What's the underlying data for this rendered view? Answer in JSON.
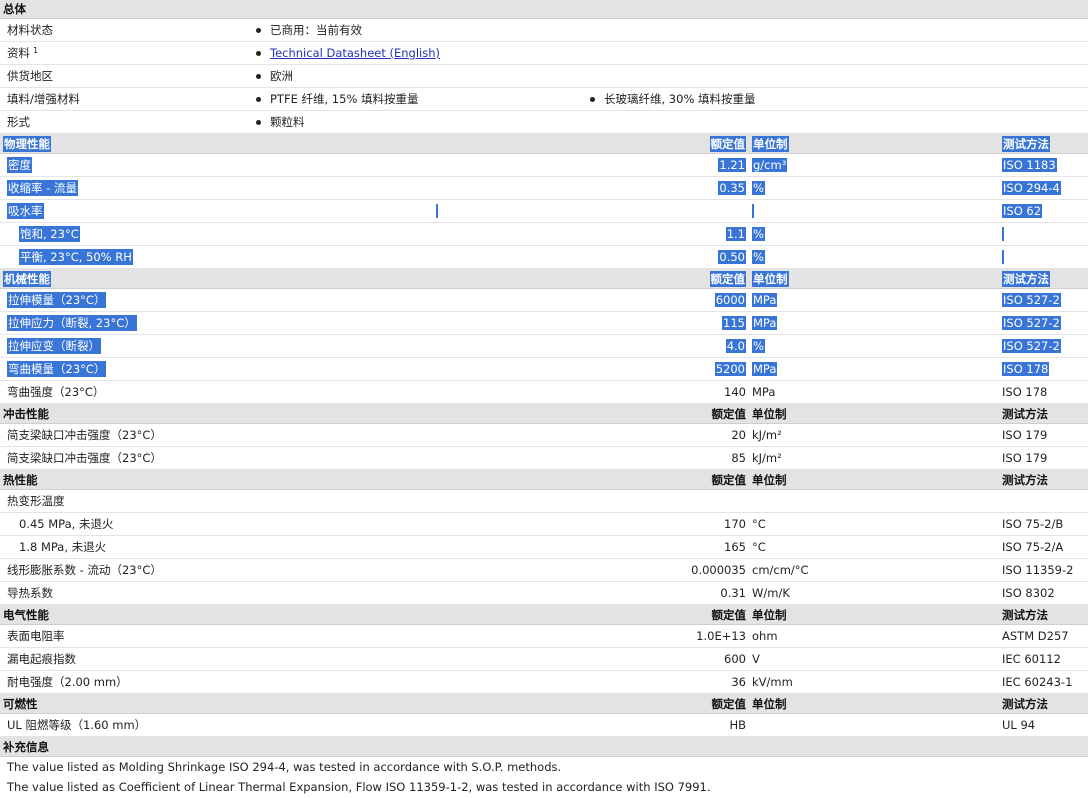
{
  "general": {
    "title": "总体",
    "rows": [
      {
        "label": "材料状态",
        "values": [
          "已商用：当前有效"
        ]
      },
      {
        "label": "资料",
        "sup": "1",
        "values": [
          "Technical Datasheet (English)"
        ],
        "link": true
      },
      {
        "label": "供货地区",
        "values": [
          "欧洲"
        ]
      },
      {
        "label": "填料/增强材料",
        "values": [
          "PTFE 纤维, 15% 填料按重量",
          "长玻璃纤维, 30% 填料按重量"
        ]
      },
      {
        "label": "形式",
        "values": [
          "颗粒料"
        ]
      }
    ]
  },
  "col_headers": {
    "value": "额定值",
    "unit": "单位制",
    "test": "测试方法"
  },
  "sections": [
    {
      "title": "物理性能",
      "highlight": true,
      "rows": [
        {
          "name": "密度",
          "value": "1.21",
          "unit": "g/cm³",
          "test": "ISO 1183",
          "hl": true
        },
        {
          "name": "收缩率 - 流量",
          "value": "0.35",
          "unit": "%",
          "test": "ISO 294-4",
          "hl": true
        },
        {
          "name": "吸水率",
          "value": "",
          "unit": "",
          "test": "ISO 62",
          "hl": true,
          "bars": true
        },
        {
          "name": "饱和, 23°C",
          "value": "1.1",
          "unit": "%",
          "test": "",
          "hl": true,
          "indent": true,
          "testbar": true
        },
        {
          "name": "平衡, 23°C, 50% RH",
          "value": "0.50",
          "unit": "%",
          "test": "",
          "hl": true,
          "indent": true,
          "testbar": true
        }
      ]
    },
    {
      "title": "机械性能",
      "highlight": true,
      "rows": [
        {
          "name": "拉伸模量（23°C）",
          "value": "6000",
          "unit": "MPa",
          "test": "ISO 527-2",
          "hl": true
        },
        {
          "name": "拉伸应力（断裂, 23°C）",
          "value": "115",
          "unit": "MPa",
          "test": "ISO 527-2",
          "hl": true
        },
        {
          "name": "拉伸应变（断裂）",
          "value": "4.0",
          "unit": "%",
          "test": "ISO 527-2",
          "hl": true
        },
        {
          "name": "弯曲模量（23°C）",
          "value": "5200",
          "unit": "MPa",
          "test": "ISO 178",
          "hl": true
        },
        {
          "name": "弯曲强度（23°C）",
          "value": "140",
          "unit": "MPa",
          "test": "ISO 178"
        }
      ]
    },
    {
      "title": "冲击性能",
      "rows": [
        {
          "name": "简支梁缺口冲击强度（23°C）",
          "value": "20",
          "unit": "kJ/m²",
          "test": "ISO 179"
        },
        {
          "name": "简支梁缺口冲击强度（23°C）",
          "value": "85",
          "unit": "kJ/m²",
          "test": "ISO 179"
        }
      ]
    },
    {
      "title": "热性能",
      "rows": [
        {
          "name": "热变形温度",
          "value": "",
          "unit": "",
          "test": ""
        },
        {
          "name": "0.45 MPa, 未退火",
          "value": "170",
          "unit": "°C",
          "test": "ISO 75-2/B",
          "indent": true
        },
        {
          "name": "1.8 MPa, 未退火",
          "value": "165",
          "unit": "°C",
          "test": "ISO 75-2/A",
          "indent": true
        },
        {
          "name": "线形膨胀系数 - 流动（23°C）",
          "value": "0.000035",
          "unit": "cm/cm/°C",
          "test": "ISO 11359-2"
        },
        {
          "name": "导热系数",
          "value": "0.31",
          "unit": "W/m/K",
          "test": "ISO 8302"
        }
      ]
    },
    {
      "title": "电气性能",
      "rows": [
        {
          "name": "表面电阻率",
          "value": "1.0E+13",
          "unit": "ohm",
          "test": "ASTM D257"
        },
        {
          "name": "漏电起痕指数",
          "value": "600",
          "unit": "V",
          "test": "IEC 60112"
        },
        {
          "name": "耐电强度（2.00 mm）",
          "value": "36",
          "unit": "kV/mm",
          "test": "IEC 60243-1"
        }
      ]
    },
    {
      "title": "可燃性",
      "rows": [
        {
          "name": "UL 阻燃等级（1.60 mm）",
          "value": "HB",
          "unit": "",
          "test": "UL 94"
        }
      ]
    }
  ],
  "notes": {
    "title": "补充信息",
    "lines": [
      "The value listed as Molding Shrinkage ISO 294-4, was tested in accordance with S.O.P. methods.",
      "The value listed as Coefficient of Linear Thermal Expansion, Flow ISO 11359-1-2, was tested in accordance with ISO 7991."
    ]
  }
}
